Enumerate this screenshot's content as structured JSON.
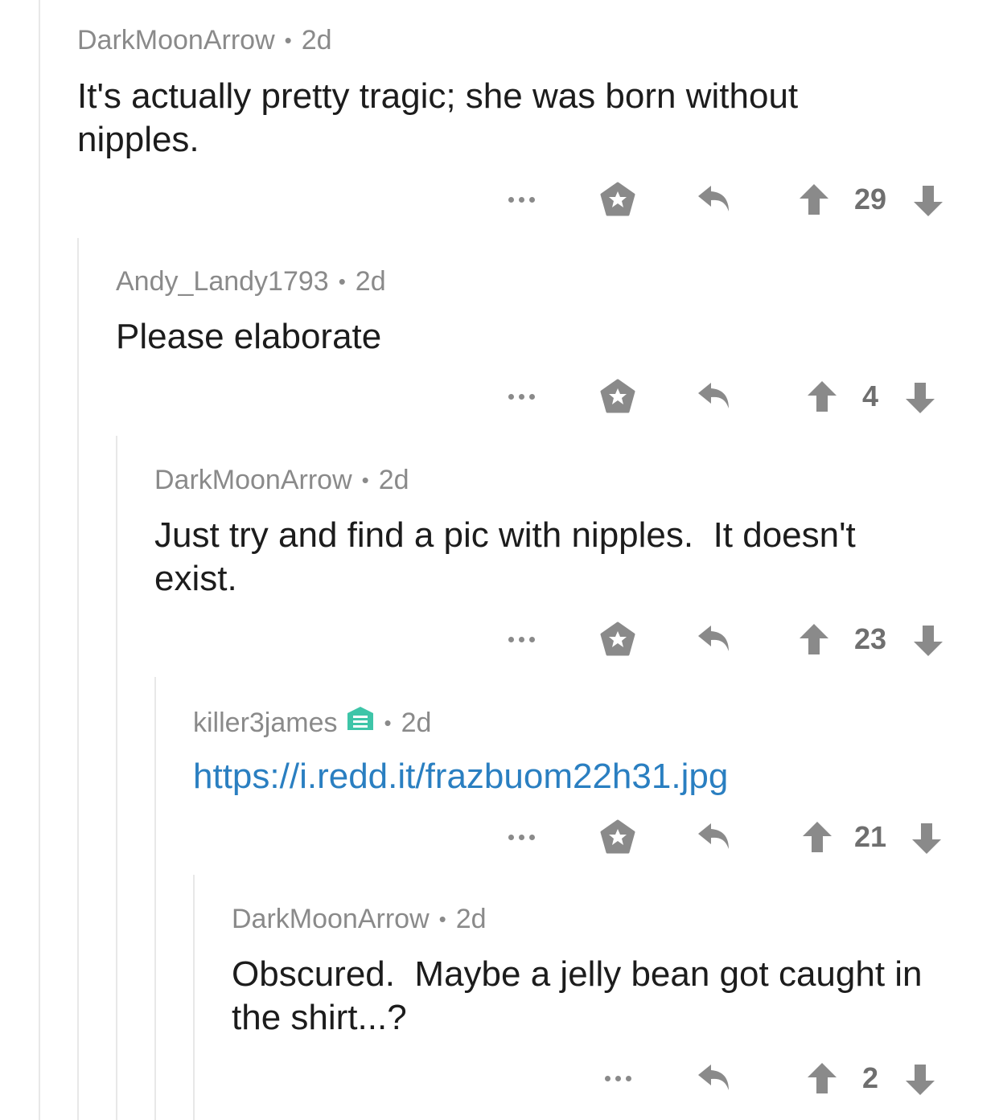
{
  "comments": [
    {
      "author": "DarkMoonArrow",
      "separator": "•",
      "age": "2d",
      "body": "It's actually pretty tragic; she was born without nipples.",
      "score": "29"
    },
    {
      "author": "Andy_Landy1793",
      "separator": "•",
      "age": "2d",
      "body": "Please elaborate",
      "score": "4"
    },
    {
      "author": "DarkMoonArrow",
      "separator": "•",
      "age": "2d",
      "body": "Just try and find a pic with nipples.  It doesn't exist.",
      "score": "23"
    },
    {
      "author": "killer3james",
      "separator": "•",
      "age": "2d",
      "body": "https://i.redd.it/frazbuom22h31.jpg",
      "score": "21"
    },
    {
      "author": "DarkMoonArrow",
      "separator": "•",
      "age": "2d",
      "body": "Obscured.  Maybe a jelly bean got caught in the shirt...?",
      "score": "2"
    }
  ],
  "icons": {
    "more": "more-icon",
    "award": "award-icon",
    "reply": "reply-icon",
    "upvote": "upvote-arrow-icon",
    "downvote": "downvote-arrow-icon",
    "moderator": "moderator-shield-icon"
  },
  "colors": {
    "text": "#1c1c1c",
    "meta": "#8a8a8a",
    "icon": "#8a8a8a",
    "link": "#2a7fc1",
    "moderator_badge": "#3ec5a8",
    "thread_line": "#e8e8e8"
  }
}
